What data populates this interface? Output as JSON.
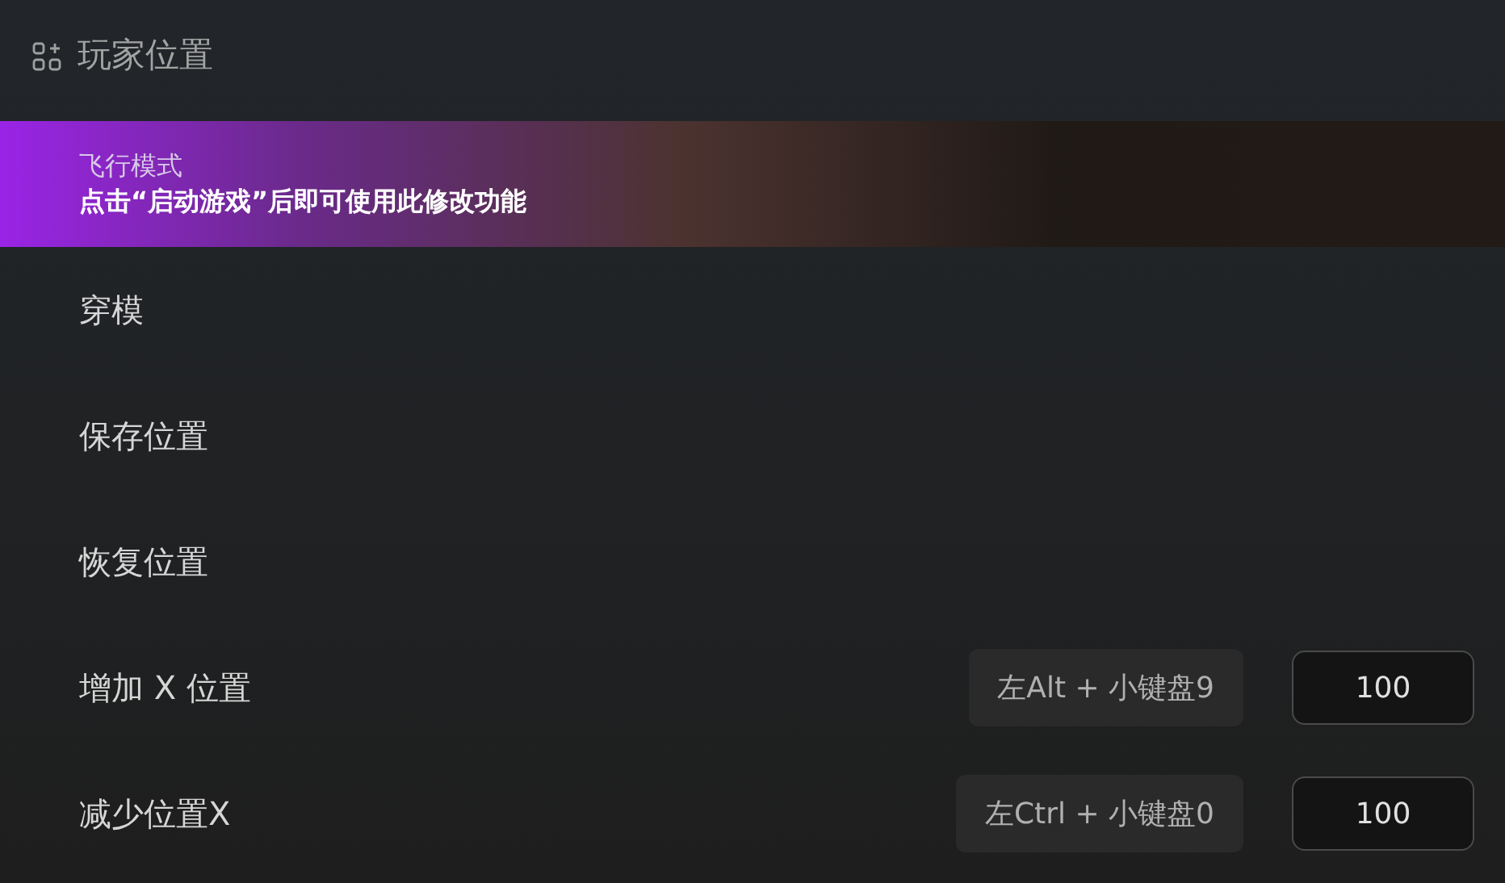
{
  "header": {
    "title": "玩家位置"
  },
  "notice": {
    "title": "飞行模式",
    "message": "点击“启动游戏”后即可使用此修改功能"
  },
  "items": [
    {
      "kind": "plain",
      "label": "穿模"
    },
    {
      "kind": "plain",
      "label": "保存位置"
    },
    {
      "kind": "plain",
      "label": "恢复位置"
    },
    {
      "kind": "hotkey",
      "label": "增加 X 位置",
      "hotkey": "左Alt + 小键盘9",
      "value": "100"
    },
    {
      "kind": "hotkey",
      "label": "减少位置X",
      "hotkey": "左Ctrl + 小键盘0",
      "value": "100"
    }
  ]
}
